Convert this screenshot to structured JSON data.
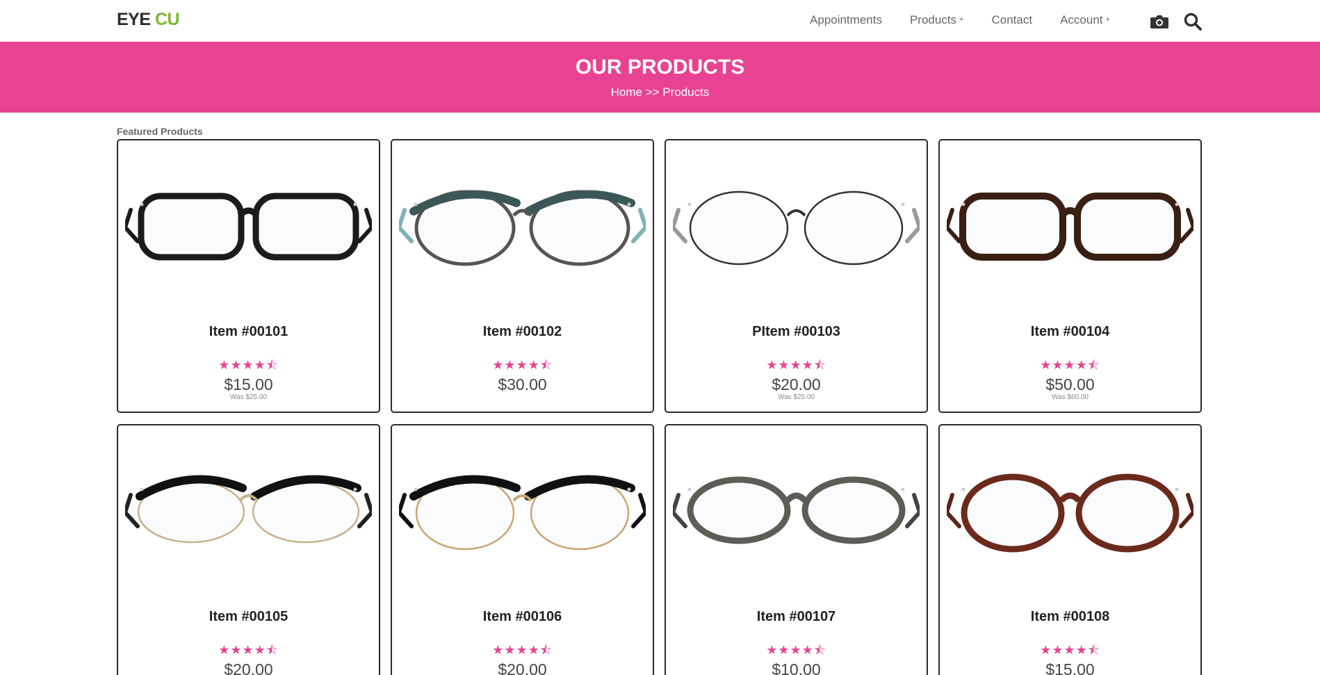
{
  "header": {
    "logo_part1": "EYE",
    "logo_part2": "CU",
    "nav": [
      {
        "label": "Appointments",
        "has_plus": false
      },
      {
        "label": "Products",
        "has_plus": true
      },
      {
        "label": "Contact",
        "has_plus": false
      },
      {
        "label": "Account",
        "has_plus": true
      }
    ],
    "plus": "+",
    "icons": [
      "camera-icon",
      "search-icon"
    ]
  },
  "banner": {
    "title": "OUR PRODUCTS",
    "breadcrumb": "Home >> Products"
  },
  "section_label": "Featured Products",
  "products": [
    {
      "name": "Item #00101",
      "rating": 4.5,
      "price": "$15.00",
      "was": "Was $25.00",
      "frame": "black-blue-wayfarer"
    },
    {
      "name": "Item #00102",
      "rating": 4.5,
      "price": "$30.00",
      "was": "",
      "frame": "teal-browline"
    },
    {
      "name": "PItem #00103",
      "rating": 4.5,
      "price": "$20.00",
      "was": "Was $25.00",
      "frame": "silver-wire-round"
    },
    {
      "name": "Item #00104",
      "rating": 4.5,
      "price": "$50.00",
      "was": "Was $60.00",
      "frame": "brown-rectangle"
    },
    {
      "name": "Item #00105",
      "rating": 4.5,
      "price": "$20.00",
      "was": "",
      "frame": "black-cateye-zebra"
    },
    {
      "name": "Item #00106",
      "rating": 4.5,
      "price": "$20.00",
      "was": "",
      "frame": "black-gold-browline"
    },
    {
      "name": "Item #00107",
      "rating": 4.5,
      "price": "$10.00",
      "was": "",
      "frame": "grey-tortoise"
    },
    {
      "name": "Item #00108",
      "rating": 4.5,
      "price": "$15.00",
      "was": "",
      "frame": "red-tortoise-round"
    }
  ],
  "colors": {
    "brand_pink": "#e84393",
    "logo_green": "#7cb82f",
    "text_dark": "#2b2b2b"
  }
}
